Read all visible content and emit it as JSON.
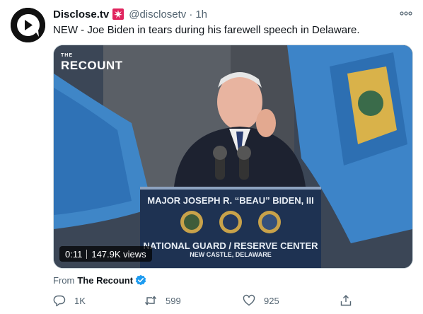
{
  "tweet": {
    "author_name": "Disclose.tv",
    "author_handle": "@disclosetv",
    "separator": "·",
    "time": "1h",
    "text": "NEW - Joe Biden in tears during his farewell speech in Delaware."
  },
  "media": {
    "watermark_small": "THE",
    "watermark_big": "RECOUNT",
    "podium_line1": "MAJOR JOSEPH R. “BEAU” BIDEN, III",
    "podium_line2": "NATIONAL GUARD / RESERVE CENTER",
    "podium_line3": "NEW CASTLE, DELAWARE",
    "duration": "0:11",
    "views": "147.9K views"
  },
  "source": {
    "prefix": "From",
    "name": "The Recount"
  },
  "actions": {
    "replies": "1K",
    "retweets": "599",
    "likes": "925"
  },
  "colors": {
    "text": "#0f1419",
    "secondary": "#536471",
    "verified": "#1d9bf0",
    "badge": "#e0245e"
  },
  "icons": [
    "logo-icon",
    "alert-badge-icon",
    "more-icon",
    "verified-icon",
    "reply-icon",
    "retweet-icon",
    "like-icon",
    "share-icon"
  ]
}
